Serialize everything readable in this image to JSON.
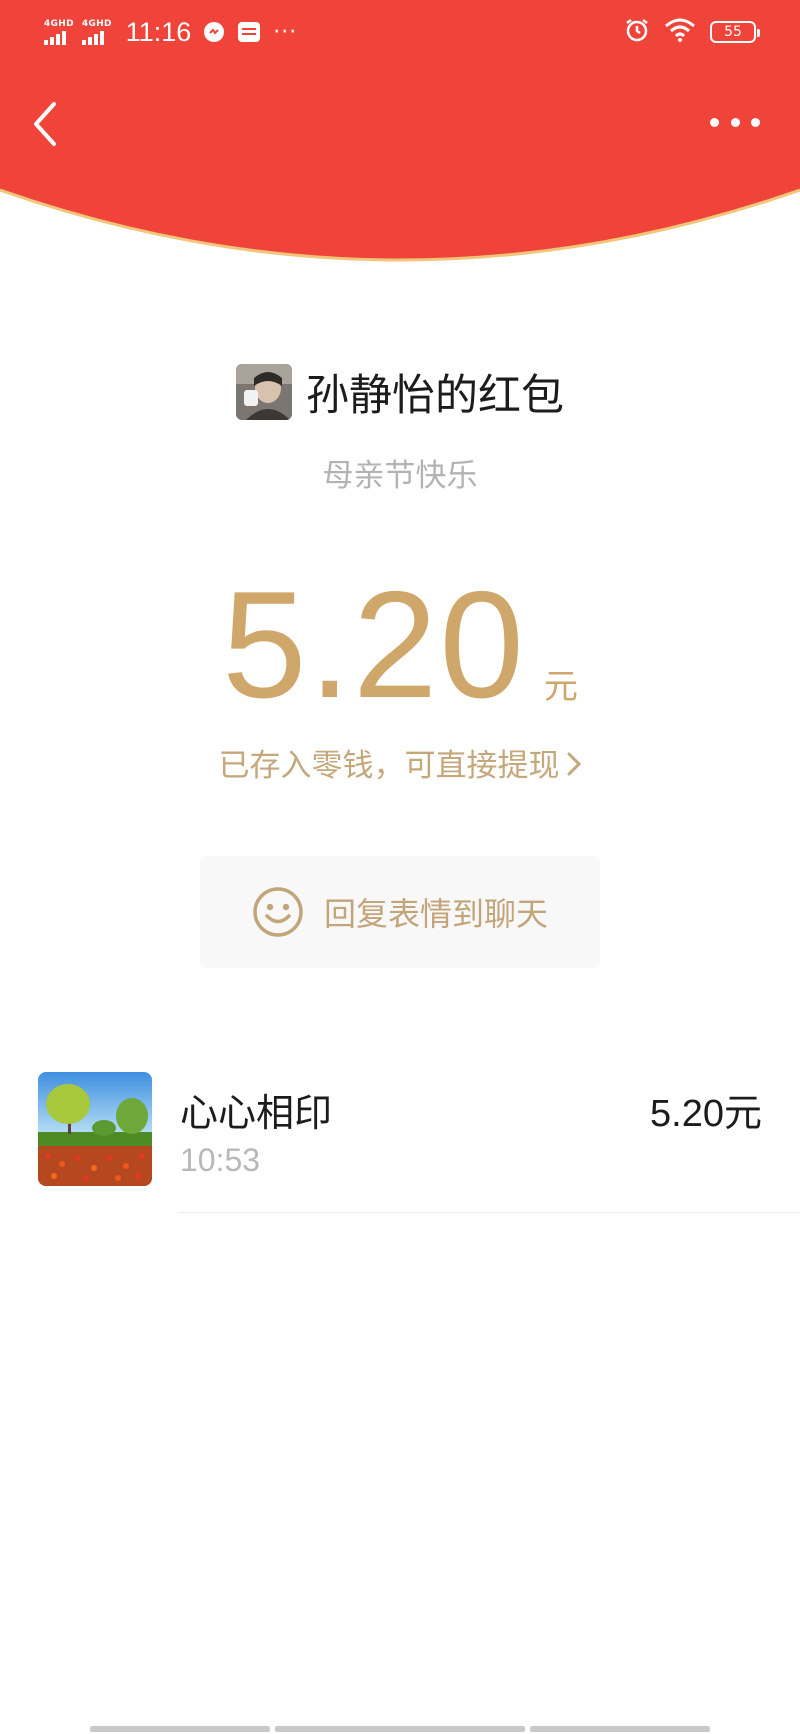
{
  "status_bar": {
    "network_1": "4GHD",
    "network_2": "4GHD",
    "time": "11:16",
    "more": "···",
    "battery": "55"
  },
  "colors": {
    "header_red": "#f0443a",
    "gold": "#cfa76a",
    "gold_text": "#c4a77a"
  },
  "icons": {
    "back": "chevron-left-icon",
    "more": "more-dots-icon",
    "smile": "smile-icon",
    "deposit_arrow": "chevron-right-icon"
  },
  "packet": {
    "sender_title": "孙静怡的红包",
    "blessing": "母亲节快乐",
    "amount": "5.20",
    "unit": "元",
    "deposit_text": "已存入零钱，可直接提现"
  },
  "reply": {
    "label": "回复表情到聊天"
  },
  "records": [
    {
      "name": "心心相印",
      "time": "10:53",
      "amount": "5.20元"
    }
  ]
}
